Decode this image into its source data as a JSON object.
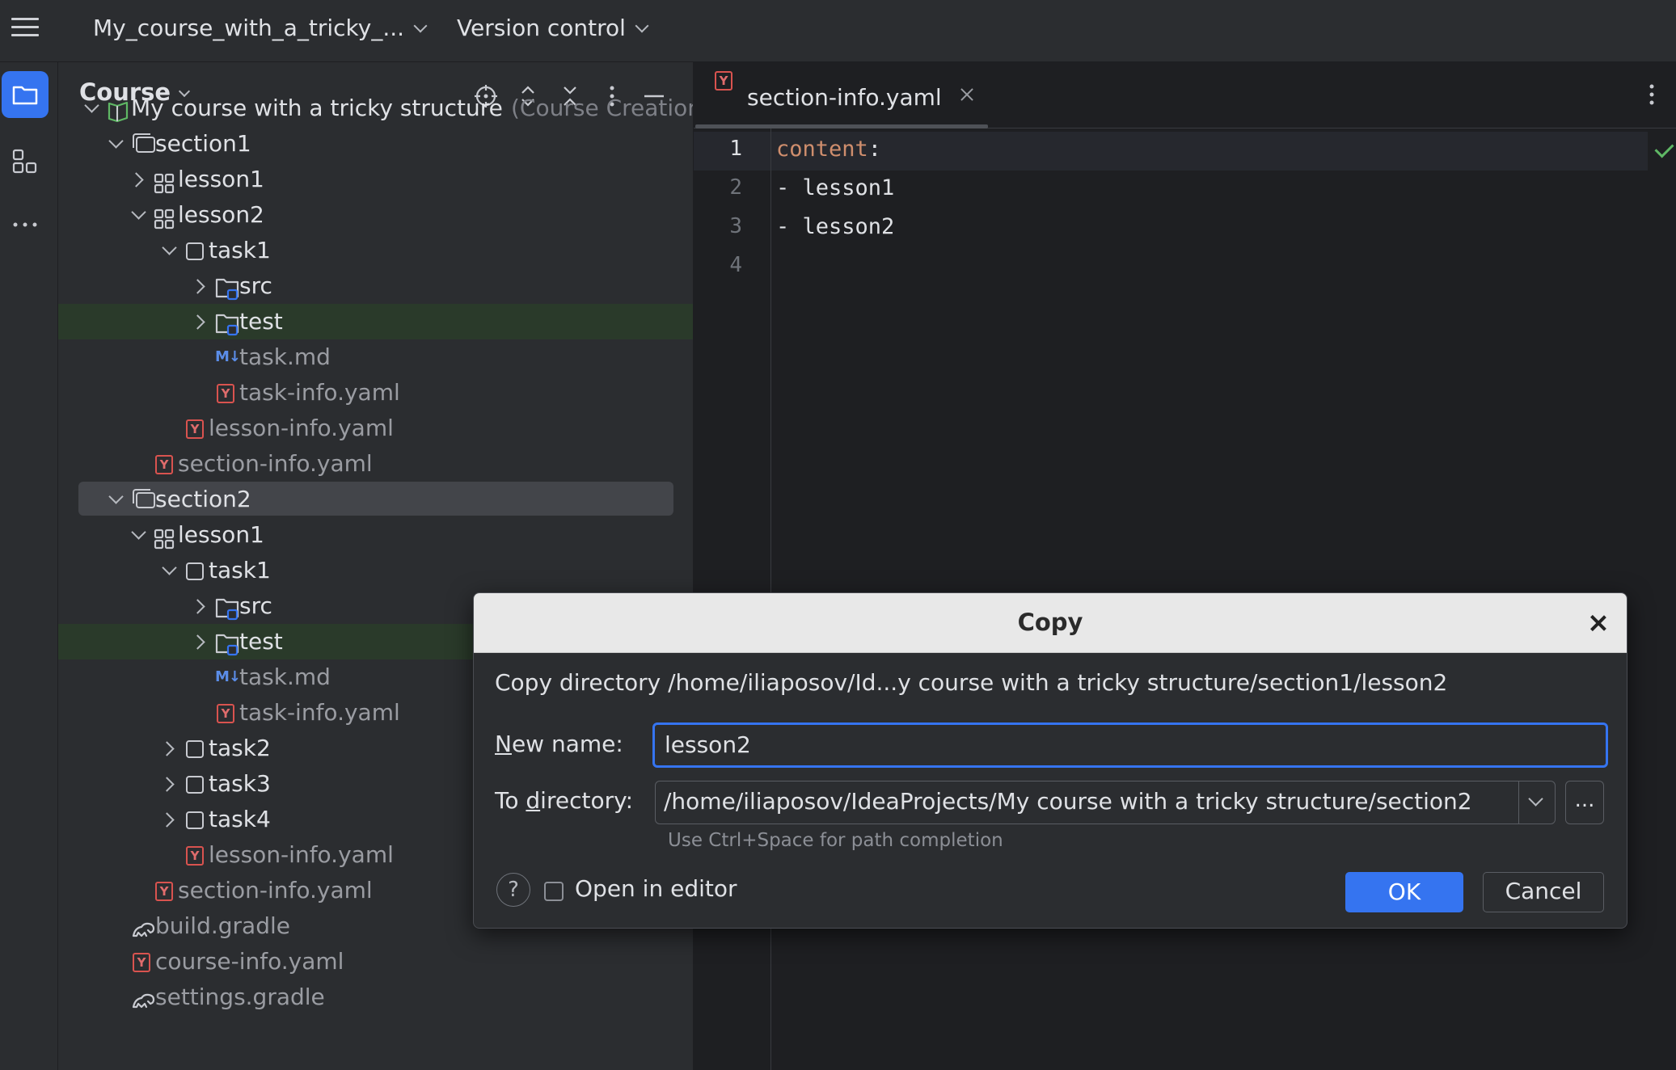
{
  "topbar": {
    "project_name": "My_course_with_a_tricky_...",
    "vcs_label": "Version control"
  },
  "toolstrip": {
    "items": [
      "project-icon",
      "structure-icon",
      "more-icon"
    ]
  },
  "project_panel": {
    "title": "Course",
    "actions": [
      "locate-icon",
      "expand-all-icon",
      "collapse-all-icon",
      "options-icon",
      "hide-icon"
    ],
    "tree": [
      {
        "label": "My course with a tricky structure",
        "suffix": "(Course Creation)",
        "icon": "course-book-icon"
      },
      {
        "label": "section1",
        "icon": "section-icon"
      },
      {
        "label": "lesson1",
        "icon": "lesson-icon"
      },
      {
        "label": "lesson2",
        "icon": "lesson-icon"
      },
      {
        "label": "task1",
        "icon": "task-icon"
      },
      {
        "label": "src",
        "icon": "source-folder-icon"
      },
      {
        "label": "test",
        "icon": "test-folder-icon"
      },
      {
        "label": "task.md",
        "icon": "markdown-icon"
      },
      {
        "label": "task-info.yaml",
        "icon": "yaml-icon"
      },
      {
        "label": "lesson-info.yaml",
        "icon": "yaml-icon"
      },
      {
        "label": "section-info.yaml",
        "icon": "yaml-icon"
      },
      {
        "label": "section2",
        "icon": "section-icon"
      },
      {
        "label": "lesson1",
        "icon": "lesson-icon"
      },
      {
        "label": "task1",
        "icon": "task-icon"
      },
      {
        "label": "src",
        "icon": "source-folder-icon"
      },
      {
        "label": "test",
        "icon": "test-folder-icon"
      },
      {
        "label": "task.md",
        "icon": "markdown-icon"
      },
      {
        "label": "task-info.yaml",
        "icon": "yaml-icon"
      },
      {
        "label": "task2",
        "icon": "task-icon"
      },
      {
        "label": "task3",
        "icon": "task-icon"
      },
      {
        "label": "task4",
        "icon": "task-icon"
      },
      {
        "label": "lesson-info.yaml",
        "icon": "yaml-icon"
      },
      {
        "label": "section-info.yaml",
        "icon": "yaml-icon"
      },
      {
        "label": "build.gradle",
        "icon": "gradle-icon"
      },
      {
        "label": "course-info.yaml",
        "icon": "yaml-icon"
      },
      {
        "label": "settings.gradle",
        "icon": "gradle-icon"
      }
    ]
  },
  "editor": {
    "tab_label": "section-info.yaml",
    "line_numbers": [
      "1",
      "2",
      "3",
      "4"
    ],
    "lines": {
      "l1_key": "content",
      "l1_colon": ":",
      "l2": "- lesson1",
      "l3": "- lesson2"
    }
  },
  "dialog": {
    "title": "Copy",
    "message": "Copy directory /home/iliaposov/Id...y course with a tricky structure/section1/lesson2",
    "new_name_label_mnemonic": "N",
    "new_name_label_rest": "ew name:",
    "new_name_value": "lesson2",
    "to_dir_label_pre": "To ",
    "to_dir_label_mnemonic": "d",
    "to_dir_label_rest": "irectory:",
    "to_dir_value": "/home/iliaposov/IdeaProjects/My course with a tricky structure/section2",
    "browse_label": "...",
    "hint": "Use Ctrl+Space for path completion",
    "help_label": "?",
    "open_in_editor_label": "Open in editor",
    "ok_label": "OK",
    "cancel_label": "Cancel"
  },
  "colors": {
    "accent": "#3574f0",
    "yaml_key": "#cf8e6d",
    "test_folder_bg": "#2a3a2a",
    "selection": "#43454a"
  }
}
